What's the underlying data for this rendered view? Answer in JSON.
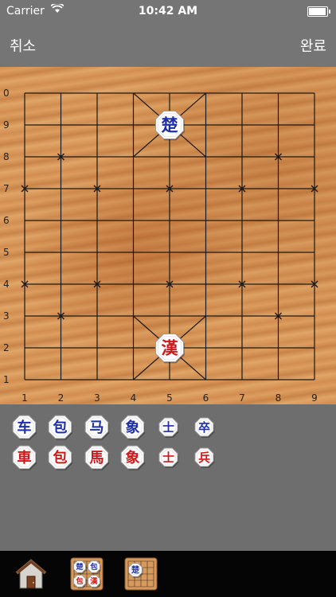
{
  "status_bar": {
    "carrier": "Carrier",
    "time": "10:42 AM",
    "battery_level": 1.0
  },
  "nav": {
    "cancel_label": "취소",
    "done_label": "완료"
  },
  "board": {
    "rank_labels": [
      "0",
      "9",
      "8",
      "7",
      "6",
      "5",
      "4",
      "3",
      "2",
      "1"
    ],
    "file_labels": [
      "1",
      "2",
      "3",
      "4",
      "5",
      "6",
      "7",
      "8",
      "9"
    ],
    "generals": [
      {
        "glyph": "楚",
        "color": "#1f2fa8",
        "side": "blue",
        "file": 5,
        "rank": "9"
      },
      {
        "glyph": "漢",
        "color": "#cc1a1a",
        "side": "red",
        "file": 5,
        "rank": "2"
      }
    ]
  },
  "reserve": {
    "blue": [
      "车",
      "包",
      "马",
      "象",
      "士",
      "卒"
    ],
    "red": [
      "車",
      "包",
      "馬",
      "象",
      "士",
      "兵"
    ],
    "colors": {
      "blue": "#1f2fa8",
      "red": "#cc1a1a"
    }
  },
  "tab_bar": {
    "home_icon": "home-icon",
    "tab2_glyphs": [
      "楚",
      "包",
      "包",
      "漢"
    ],
    "tab3_glyph": "楚"
  }
}
